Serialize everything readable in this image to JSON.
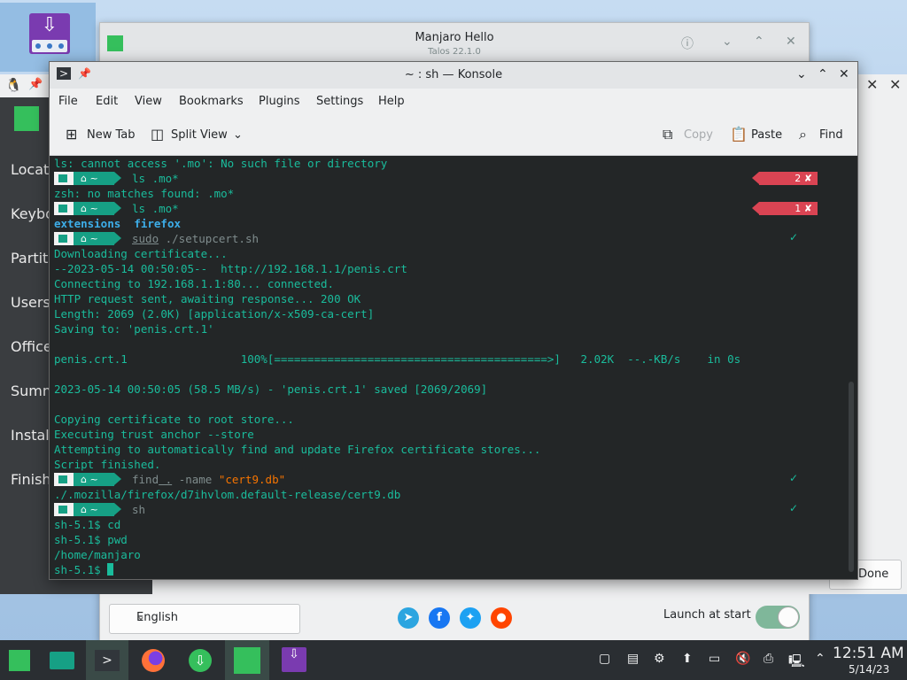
{
  "hello": {
    "title": "Manjaro Hello",
    "subtitle": "Talos 22.1.0",
    "language": "English",
    "launch_label": "Launch at start",
    "launch_on": true
  },
  "installer": {
    "sidebar": [
      "Locati",
      "Keybo",
      "Partiti",
      "Users",
      "Office",
      "Summ",
      "Instal",
      "Finish"
    ],
    "done_label": "Done"
  },
  "konsole": {
    "title": "~ : sh — Konsole",
    "menu": [
      "File",
      "Edit",
      "View",
      "Bookmarks",
      "Plugins",
      "Settings",
      "Help"
    ],
    "toolbar": {
      "new_tab": "New Tab",
      "split_view": "Split View",
      "copy": "Copy",
      "paste": "Paste",
      "find": "Find"
    },
    "prompt_dir": "~",
    "lines": {
      "l1": "ls: cannot access '.mo': No such file or directory",
      "c1": "ls .mo*",
      "e1": "2 ✘",
      "l2": "zsh: no matches found: .mo*",
      "c2": "ls .mo*",
      "e2": "1 ✘",
      "l3a": "extensions",
      "l3b": "firefox",
      "c3a": "sudo",
      "c3b": " ./setupcert.sh",
      "l4": "Downloading certificate...",
      "l5": "--2023-05-14 00:50:05--  http://192.168.1.1/penis.crt",
      "l6": "Connecting to 192.168.1.1:80... connected.",
      "l7": "HTTP request sent, awaiting response... 200 OK",
      "l8": "Length: 2069 (2.0K) [application/x-x509-ca-cert]",
      "l9": "Saving to: 'penis.crt.1'",
      "l10": "penis.crt.1                 100%[=========================================>]   2.02K  --.-KB/s    in 0s",
      "l11": "2023-05-14 00:50:05 (58.5 MB/s) - 'penis.crt.1' saved [2069/2069]",
      "l12": "Copying certificate to root store...",
      "l13": "Executing trust anchor --store",
      "l14": "Attempting to automatically find and update Firefox certificate stores...",
      "l15": "Script finished.",
      "c4a": "find",
      "c4b": " .",
      "c4c": " -name ",
      "c4d": "\"cert9.db\"",
      "l16": "./.mozilla/firefox/d7ihvlom.default-release/cert9.db",
      "c5": "sh",
      "l17": "sh-5.1$ cd",
      "l18": "sh-5.1$ pwd",
      "l19": "/home/manjaro",
      "l20": "sh-5.1$ ",
      "ok": "✓"
    }
  },
  "taskbar": {
    "time": "12:51 AM",
    "date": "5/14/23"
  },
  "colors": {
    "terminal_bg": "#232627",
    "terminal_fg": "#1abc9c",
    "error": "#da4453",
    "accent": "#16a085"
  }
}
